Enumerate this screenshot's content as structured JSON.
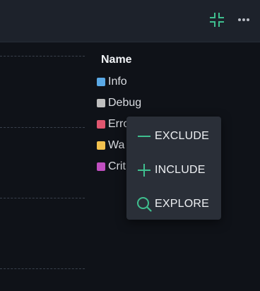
{
  "legend": {
    "title": "Name",
    "items": [
      {
        "label": "Info",
        "color": "#5aa9e6"
      },
      {
        "label": "Debug",
        "color": "#bfbfbf"
      },
      {
        "label": "Erro",
        "color": "#e0566f"
      },
      {
        "label": "Wa",
        "color": "#f2c14e"
      },
      {
        "label": "Crit",
        "color": "#c04fc0"
      }
    ]
  },
  "context_menu": {
    "items": [
      {
        "label": "EXCLUDE",
        "icon": "minus-icon"
      },
      {
        "label": "INCLUDE",
        "icon": "plus-icon"
      },
      {
        "label": "EXPLORE",
        "icon": "search-icon"
      }
    ]
  },
  "header": {
    "actions": [
      {
        "icon": "collapse-icon",
        "color": "#3fbf8f"
      },
      {
        "icon": "more-horizontal-icon",
        "color": "#b8bcc4"
      }
    ]
  },
  "colors": {
    "accent": "#3fbf8f",
    "background": "#0f1218",
    "header": "#1d222b",
    "menu": "#2a2f38"
  }
}
